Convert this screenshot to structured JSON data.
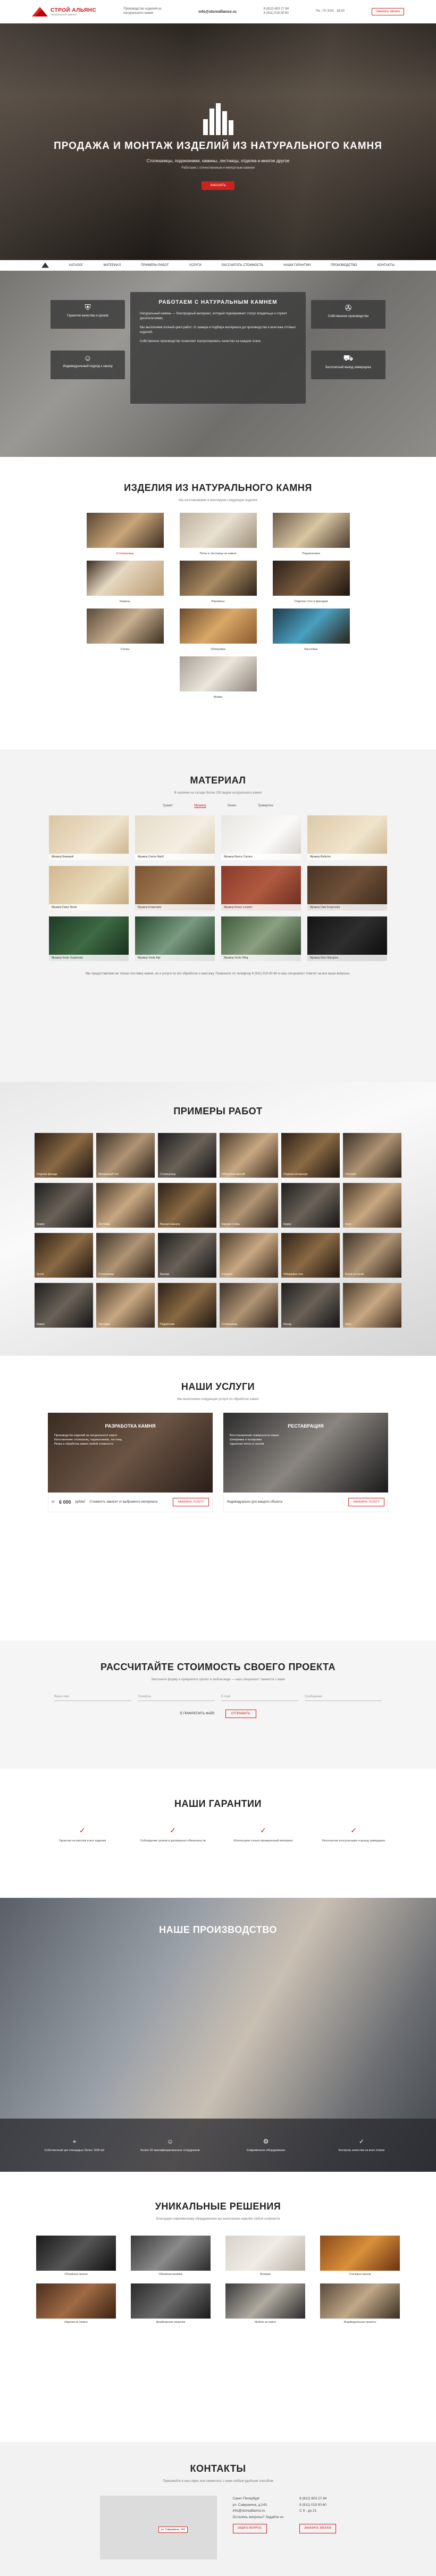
{
  "header": {
    "brand": "СТРОЙ АЛЬЯНС",
    "brand_sub": "натуральный камень",
    "tagline": "Производство изделий из натурального камня",
    "email": "info@storealliance.ru",
    "phone1": "8 (812) 603 27 84",
    "phone2": "8 (911) 019 00 60",
    "hours": "Пн - Пт\n9:00 - 18:00",
    "callback": "Заказать звонок"
  },
  "hero": {
    "title": "ПРОДАЖА И МОНТАЖ ИЗДЕЛИЙ ИЗ НАТУРАЛЬНОГО КАМНЯ",
    "subtitle": "Столешницы, подоконники, камины, лестницы, отделка и многое другое",
    "subtitle2": "Работаем с отечественным и импортным камнем",
    "cta": "ЗАКАЗАТЬ"
  },
  "nav": [
    "Каталог",
    "Материал",
    "Примеры работ",
    "Услуги",
    "Рассчитать стоимость",
    "Наши гарантии",
    "Производство",
    "Контакты"
  ],
  "work": {
    "title": "РАБОТАЕМ С НАТУРАЛЬНЫМ КАМНЕМ",
    "p1": "Натуральный камень — благородный материал, который подчёркивает статус владельца и служит десятилетиями.",
    "p2": "Мы выполняем полный цикл работ: от замера и подбора материала до производства и монтажа готовых изделий.",
    "p3": "Собственное производство позволяет контролировать качество на каждом этапе.",
    "features": [
      "Гарантия качества и сроков",
      "Собственное производство",
      "Индивидуальный подход к заказу",
      "Бесплатный выезд замерщика"
    ]
  },
  "products": {
    "title": "ИЗДЕЛИЯ ИЗ НАТУРАЛЬНОГО КАМНЯ",
    "sub": "Мы изготавливаем и монтируем следующие изделия",
    "items": [
      "Столешницы",
      "Полы и лестницы из камня",
      "Подоконники",
      "Камины",
      "Раковины",
      "Отделка стен и фасадов",
      "Столы",
      "Облицовка",
      "Бассейны",
      "Мойки"
    ]
  },
  "material": {
    "title": "МАТЕРИАЛ",
    "sub": "В наличии на складе более 200 видов натурального камня",
    "tabs": [
      "Гранит",
      "Мрамор",
      "Оникс",
      "Травертин"
    ],
    "active_tab": 1,
    "items": [
      "Мрамор Бежевый",
      "Мрамор Crema Marfil",
      "Мрамор Bianco Carrara",
      "Мрамор Botticino",
      "Мрамор Daino Reale",
      "Мрамор Emperador",
      "Мрамор Rosso Levanto",
      "Мрамор Dark Emperador",
      "Мрамор Verde Guatemala",
      "Мрамор Verde Alpi",
      "Мрамор Verde Ming",
      "Мрамор Nero Marquina"
    ],
    "note": "Мы предоставляем не только поставку камня, но и услуги по его обработке и монтажу. Позвоните по телефону 8 (911) 019-00-60 и наш специалист ответит на все ваши вопросы."
  },
  "examples": {
    "title": "ПРИМЕРЫ РАБОТ",
    "items": [
      "Отделка фасада",
      "Мраморный пол",
      "Столешница",
      "Облицовка ванной",
      "Отделка интерьера",
      "Гостиная",
      "Камин",
      "Лестница",
      "Ванная комната",
      "Барная стойка",
      "Камин",
      "Холл",
      "Кухня",
      "Столешница",
      "Ванная",
      "Спальня",
      "Облицовка стен",
      "Кухня-гостиная",
      "Камин",
      "Лестница",
      "Подоконник",
      "Столешница",
      "Фасад",
      "Холл"
    ]
  },
  "services": {
    "title": "НАШИ УСЛУГИ",
    "sub": "Мы выполняем следующие услуги по обработке камня",
    "cards": [
      {
        "title": "РАЗРАБОТКА КАМНЯ",
        "lines": [
          "Производство изделий из натурального камня",
          "Изготовление столешниц, подоконников, лестниц",
          "Резка и обработка камня любой сложности"
        ],
        "price_from": "от",
        "price": "6 000",
        "unit": "руб/м2",
        "note": "Стоимость зависит от выбранного материала",
        "order": "ЗАКАЗАТЬ УСЛУГУ"
      },
      {
        "title": "РЕСТАВРАЦИЯ",
        "lines": [
          "Восстановление поверхности камня",
          "Шлифовка и полировка",
          "Удаление пятен и сколов"
        ],
        "price_from": "",
        "price": "",
        "unit": "",
        "note": "Индивидуально для каждого объекта",
        "order": "ЗАКАЗАТЬ УСЛУГУ"
      }
    ]
  },
  "calc": {
    "title": "РАССЧИТАЙТЕ СТОИМОСТЬ СВОЕГО ПРОЕКТА",
    "sub": "Заполните форму и прикрепите проект в любом виде — наш специалист свяжется с вами",
    "fields": [
      "Ваше имя",
      "Телефон",
      "E-mail",
      "Сообщение"
    ],
    "attach": "ПРИКРЕПИТЬ ФАЙЛ",
    "submit": "ОТПРАВИТЬ"
  },
  "guarantees": {
    "title": "НАШИ ГАРАНТИИ",
    "items": [
      "Гарантия на монтаж и все изделия",
      "Соблюдение сроков и договорных обязательств",
      "Используем только проверенный материал",
      "Бесплатная консультация и выезд замерщика"
    ]
  },
  "production": {
    "title": "НАШЕ ПРОИЗВОДСТВО",
    "items": [
      "Собственный цех площадью более 1000 м2",
      "Более 50 квалифицированных сотрудников",
      "Современное оборудование",
      "Контроль качества на всех этапах"
    ]
  },
  "unique": {
    "title": "УНИКАЛЬНЫЕ РЕШЕНИЯ",
    "sub": "Благодаря современному оборудованию мы выполняем изделия любой сложности",
    "items": [
      "Объемные панели",
      "Объемная мозаика",
      "Мозаика",
      "Стеновые панели",
      "Изделия из оникса",
      "Дизайнерские решения",
      "Мебель из камня",
      "Индивидуальные проекты"
    ]
  },
  "contacts": {
    "title": "КОНТАКТЫ",
    "sub": "Приезжайте в наш офис или свяжитесь с нами любым удобным способом",
    "city": "Санкт-Петербург",
    "address": "ул. Савушкина, д.143",
    "email": "info@storealliance.ru",
    "phone1": "8 (812) 603 27 84",
    "phone2": "8 (911) 019 00 60",
    "hours": "С 9 - до 21",
    "question": "Остались вопросы? Задайте их",
    "ask": "ЗАДАТЬ ВОПРОС",
    "callback": "ЗАКАЗАТЬ ЗВОНОК",
    "map_pin": "ул. Савушкина, 143"
  }
}
